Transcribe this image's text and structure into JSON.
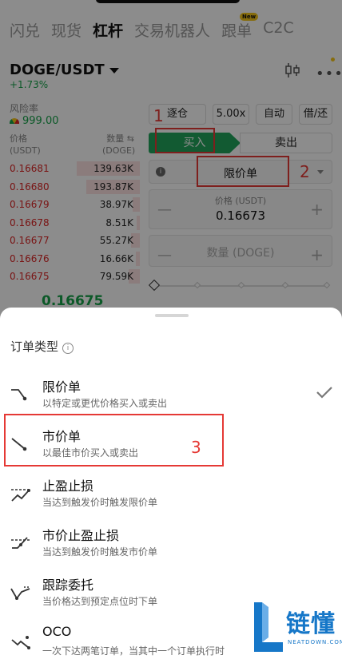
{
  "top_tabs": [
    "闪兑",
    "现货",
    "杠杆",
    "交易机器人",
    "跟单",
    "C2C"
  ],
  "new_badge": "New",
  "pair": "DOGE/USDT",
  "change": "+1.73%",
  "risk": {
    "label": "风险率",
    "value": "999.00"
  },
  "orderbook": {
    "price_header": "价格\n(USDT)",
    "qty_header": "数量 ⇆\n(DOGE)",
    "rows": [
      {
        "price": "0.16681",
        "qty": "139.63K",
        "depth": 0.45
      },
      {
        "price": "0.16680",
        "qty": "193.87K",
        "depth": 0.38
      },
      {
        "price": "0.16679",
        "qty": "38.97K",
        "depth": 0.05
      },
      {
        "price": "0.16678",
        "qty": "8.51K",
        "depth": 0.02
      },
      {
        "price": "0.16677",
        "qty": "55.27K",
        "depth": 0.06
      },
      {
        "price": "0.16676",
        "qty": "16.66K",
        "depth": 0.03
      },
      {
        "price": "0.16675",
        "qty": "79.59K",
        "depth": 0.08
      }
    ],
    "last_price": "0.16675"
  },
  "options": {
    "margin_mode": "逐仓",
    "leverage": "5.00x",
    "auto": "自动",
    "borrow": "借/还"
  },
  "side": {
    "buy": "买入",
    "sell": "卖出"
  },
  "order_type_selected": "限价单",
  "price_field": {
    "label": "价格 (USDT)",
    "value": "0.16673"
  },
  "qty_field": {
    "placeholder": "数量 (DOGE)"
  },
  "annotations": [
    "1",
    "2",
    "3"
  ],
  "sheet": {
    "title": "订单类型",
    "items": [
      {
        "name": "限价单",
        "desc": "以特定或更优价格买入或卖出",
        "icon": "limit-order-icon",
        "checked": true
      },
      {
        "name": "市价单",
        "desc": "以最佳市价买入或卖出",
        "icon": "market-order-icon",
        "checked": false
      },
      {
        "name": "止盈止损",
        "desc": "当达到触发价时触发限价单",
        "icon": "tp-sl-icon",
        "checked": false
      },
      {
        "name": "市价止盈止损",
        "desc": "当达到触发价时触发市价单",
        "icon": "market-tp-sl-icon",
        "checked": false
      },
      {
        "name": "跟踪委托",
        "desc": "当价格达到预定点位时下单",
        "icon": "trailing-order-icon",
        "checked": false
      },
      {
        "name": "OCO",
        "desc": "一次下达两笔订单，当其中一个订单执行时",
        "icon": "oco-icon",
        "checked": false
      }
    ]
  },
  "watermark": {
    "cn": "链懂",
    "en": "NEATDOWN.COM"
  },
  "colors": {
    "buy": "#22a55b",
    "sell": "#dc2626",
    "annotation": "#e53935",
    "brand": "#1677c8"
  }
}
